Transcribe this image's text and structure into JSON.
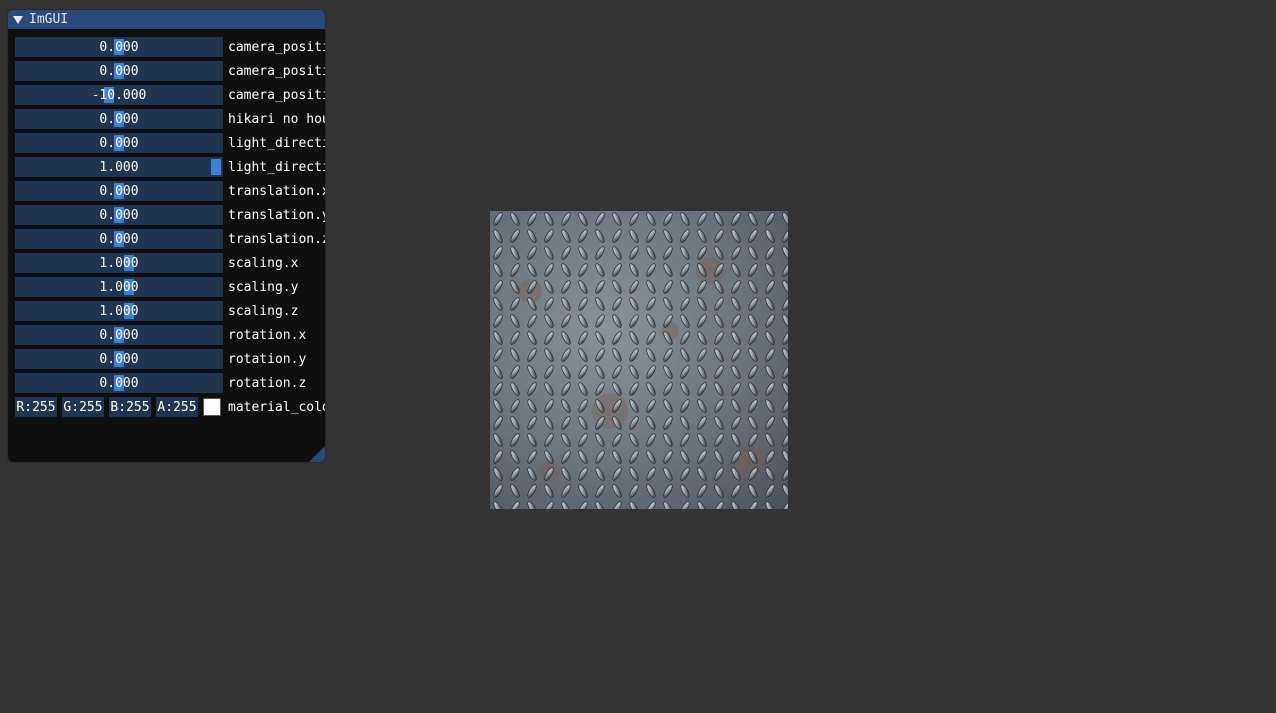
{
  "window": {
    "title": "ImGUI",
    "collapse_icon": "triangle-down-icon",
    "title_bg": "#294a7a",
    "accent": "#3d80d6",
    "frame_bg": "#1f3550"
  },
  "fields": [
    {
      "label": "camera_position.x",
      "value": "0.000",
      "grab_fraction": 0.5
    },
    {
      "label": "camera_position.y",
      "value": "0.000",
      "grab_fraction": 0.5
    },
    {
      "label": "camera_position.z",
      "value": "-10.000",
      "grab_fraction": 0.45
    },
    {
      "label": "hikari no houkou",
      "value": "0.000",
      "grab_fraction": 0.5
    },
    {
      "label": "light_direction.x",
      "value": "0.000",
      "grab_fraction": 0.5
    },
    {
      "label": "light_direction.y",
      "value": "1.000",
      "grab_fraction": 1.0
    },
    {
      "label": "translation.x",
      "value": "0.000",
      "grab_fraction": 0.5
    },
    {
      "label": "translation.y",
      "value": "0.000",
      "grab_fraction": 0.5
    },
    {
      "label": "translation.z",
      "value": "0.000",
      "grab_fraction": 0.5
    },
    {
      "label": "scaling.x",
      "value": "1.000",
      "grab_fraction": 0.55
    },
    {
      "label": "scaling.y",
      "value": "1.000",
      "grab_fraction": 0.55
    },
    {
      "label": "scaling.z",
      "value": "1.000",
      "grab_fraction": 0.55
    },
    {
      "label": "rotation.x",
      "value": "0.000",
      "grab_fraction": 0.5
    },
    {
      "label": "rotation.y",
      "value": "0.000",
      "grab_fraction": 0.5
    },
    {
      "label": "rotation.z",
      "value": "0.000",
      "grab_fraction": 0.5
    }
  ],
  "material_color": {
    "label": "material_color",
    "r": "R:255",
    "g": "G:255",
    "b": "B:255",
    "a": "A:255",
    "swatch": "#ffffff"
  },
  "viewport": {
    "content": "diamond-plate-metal-texture"
  }
}
